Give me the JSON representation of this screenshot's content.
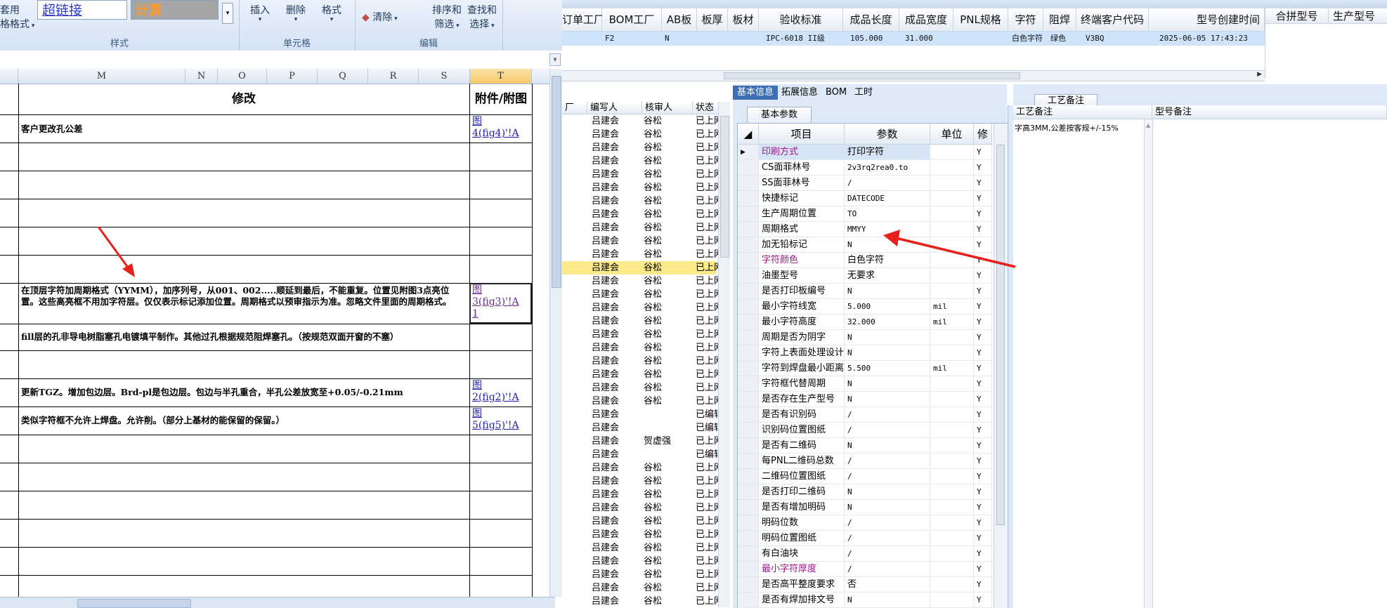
{
  "ribbon": {
    "style_group": {
      "label": "样式",
      "btn1": "套用",
      "btn2": "格格式",
      "hyperlink_style": "超链接",
      "calc_style": "计算"
    },
    "cells_group": {
      "label": "单元格",
      "insert": "插入",
      "delete": "删除",
      "format": "格式"
    },
    "edit_group": {
      "label": "编辑",
      "clear": "清除",
      "sort_filter_1": "排序和",
      "sort_filter_2": "筛选",
      "find_select_1": "查找和",
      "find_select_2": "选择"
    }
  },
  "sheet": {
    "columns": [
      "M",
      "N",
      "O",
      "P",
      "Q",
      "R",
      "S",
      "T"
    ],
    "header_modify": "修改",
    "header_attach": "附件/附图",
    "rows": [
      {
        "text": "客户更改孔公差",
        "link": "图\n4(fig4)'!A"
      },
      {
        "text": "",
        "link": ""
      },
      {
        "text": "",
        "link": ""
      },
      {
        "text": "",
        "link": ""
      },
      {
        "text": "",
        "link": ""
      },
      {
        "text": "",
        "link": ""
      },
      {
        "text": "在顶层字符加周期格式（YYMM），加序列号，从001、002.....顺延到最后，不能重复。位置见附图3点亮位置。这些高亮框不用加字符层。仅仅表示标记添加位置。周期格式以预审指示为准。忽略文件里面的周期格式。",
        "link": "图\n3(fig3)'!A\n1"
      },
      {
        "text": "fill层的孔非导电树脂塞孔电镀填平制作。其他过孔根据规范阻焊塞孔。（按规范双面开窗的不塞）",
        "link": ""
      },
      {
        "text": "",
        "link": ""
      },
      {
        "text": "更新TGZ。增加包边层。Brd-pl是包边层。包边与半孔重合，半孔公差放宽至+0.05/-0.21mm",
        "link": "图\n2(fig2)'!A"
      },
      {
        "text": "类似字符框不允许上焊盘。允许削。（部分上基材的能保留的保留。）",
        "link": "图\n5(fig5)'!A"
      }
    ]
  },
  "erp_top": {
    "headers": [
      "订单工厂",
      "BOM工厂",
      "AB板",
      "板厚",
      "板材",
      "验收标准",
      "成品长度",
      "成品宽度",
      "PNL规格",
      "字符",
      "阻焊",
      "终端客户代码",
      "型号创建时间",
      "合拼型号",
      "生产型号"
    ],
    "row": [
      "F2",
      "N",
      "",
      "",
      "IPC-6018 II级",
      "105.000",
      "31.000",
      "",
      "白色字符",
      "绿色",
      "V3BQ",
      "2025-06-05 17:43:23"
    ]
  },
  "erp_list": {
    "headers": [
      "订单工厂",
      "编写人",
      "核审人",
      "状态"
    ],
    "rows": [
      [
        "吕建会",
        "谷松",
        "已上网"
      ],
      [
        "吕建会",
        "谷松",
        "已上网"
      ],
      [
        "吕建会",
        "谷松",
        "已上网"
      ],
      [
        "吕建会",
        "谷松",
        "已上网"
      ],
      [
        "吕建会",
        "谷松",
        "已上网"
      ],
      [
        "吕建会",
        "谷松",
        "已上网"
      ],
      [
        "吕建会",
        "谷松",
        "已上网"
      ],
      [
        "吕建会",
        "谷松",
        "已上网"
      ],
      [
        "吕建会",
        "谷松",
        "已上网"
      ],
      [
        "吕建会",
        "谷松",
        "已上网"
      ],
      [
        "吕建会",
        "谷松",
        "已上网"
      ],
      [
        "吕建会",
        "谷松",
        "已上网"
      ],
      [
        "吕建会",
        "谷松",
        "已上网"
      ],
      [
        "吕建会",
        "谷松",
        "已上网"
      ],
      [
        "吕建会",
        "谷松",
        "已上网"
      ],
      [
        "吕建会",
        "谷松",
        "已上网"
      ],
      [
        "吕建会",
        "谷松",
        "已上网"
      ],
      [
        "吕建会",
        "谷松",
        "已上网"
      ],
      [
        "吕建会",
        "谷松",
        "已上网"
      ],
      [
        "吕建会",
        "谷松",
        "已上网"
      ],
      [
        "吕建会",
        "谷松",
        "已上网"
      ],
      [
        "吕建会",
        "谷松",
        "已上网"
      ],
      [
        "吕建会",
        "",
        "已编辑"
      ],
      [
        "吕建会",
        "",
        "已编辑"
      ],
      [
        "吕建会",
        "贺虚强",
        "已上网"
      ],
      [
        "吕建会",
        "",
        "已编辑"
      ],
      [
        "吕建会",
        "谷松",
        "已上网"
      ],
      [
        "吕建会",
        "谷松",
        "已上网"
      ],
      [
        "吕建会",
        "谷松",
        "已上网"
      ],
      [
        "吕建会",
        "谷松",
        "已上网"
      ],
      [
        "吕建会",
        "谷松",
        "已上网"
      ],
      [
        "吕建会",
        "谷松",
        "已上网"
      ],
      [
        "吕建会",
        "谷松",
        "已上网"
      ],
      [
        "吕建会",
        "谷松",
        "已上网"
      ],
      [
        "吕建会",
        "谷松",
        "已上网"
      ],
      [
        "吕建会",
        "谷松",
        "已上网"
      ],
      [
        "吕建会",
        "谷松",
        "已上网"
      ]
    ],
    "highlight_row": 11
  },
  "detail": {
    "tabs": [
      "基本信息",
      "拓展信息",
      "BOM",
      "工时"
    ],
    "subtab": "基本参数",
    "prop_headers": [
      "项目",
      "参数",
      "单位",
      "修"
    ],
    "props": [
      {
        "name": "印刷方式",
        "value": "打印字符",
        "unit": "",
        "flag": "Y",
        "pink": true
      },
      {
        "name": "CS面菲林号",
        "value": "2v3rq2rea0.to",
        "unit": "",
        "flag": "Y"
      },
      {
        "name": "SS面菲林号",
        "value": "/",
        "unit": "",
        "flag": "Y"
      },
      {
        "name": "快捷标记",
        "value": "DATECODE",
        "unit": "",
        "flag": "Y"
      },
      {
        "name": "生产周期位置",
        "value": "TO",
        "unit": "",
        "flag": "Y"
      },
      {
        "name": "周期格式",
        "value": "MMYY",
        "unit": "",
        "flag": "Y"
      },
      {
        "name": "加无铅标记",
        "value": "N",
        "unit": "",
        "flag": "Y"
      },
      {
        "name": "字符颜色",
        "value": "白色字符",
        "unit": "",
        "flag": "Y",
        "pink": true
      },
      {
        "name": "油墨型号",
        "value": "无要求",
        "unit": "",
        "flag": "Y"
      },
      {
        "name": "是否打印板编号",
        "value": "N",
        "unit": "",
        "flag": "Y"
      },
      {
        "name": "最小字符线宽",
        "value": "5.000",
        "unit": "mil",
        "flag": "Y"
      },
      {
        "name": "最小字符高度",
        "value": "32.000",
        "unit": "mil",
        "flag": "Y"
      },
      {
        "name": "周期是否为阴字",
        "value": "N",
        "unit": "",
        "flag": "Y"
      },
      {
        "name": "字符上表面处理设计",
        "value": "N",
        "unit": "",
        "flag": "Y"
      },
      {
        "name": "字符到焊盘最小距离",
        "value": "5.500",
        "unit": "mil",
        "flag": "Y"
      },
      {
        "name": "字符框代替周期",
        "value": "N",
        "unit": "",
        "flag": "Y"
      },
      {
        "name": "是否存在生产型号",
        "value": "N",
        "unit": "",
        "flag": "Y"
      },
      {
        "name": "是否有识别码",
        "value": "/",
        "unit": "",
        "flag": "Y"
      },
      {
        "name": "识别码位置图纸",
        "value": "/",
        "unit": "",
        "flag": "Y"
      },
      {
        "name": "是否有二维码",
        "value": "N",
        "unit": "",
        "flag": "Y"
      },
      {
        "name": "每PNL二维码总数",
        "value": "/",
        "unit": "",
        "flag": "Y"
      },
      {
        "name": "二维码位置图纸",
        "value": "/",
        "unit": "",
        "flag": "Y"
      },
      {
        "name": "是否打印二维码",
        "value": "N",
        "unit": "",
        "flag": "Y"
      },
      {
        "name": "是否有增加明码",
        "value": "N",
        "unit": "",
        "flag": "Y"
      },
      {
        "name": "明码位数",
        "value": "/",
        "unit": "",
        "flag": "Y"
      },
      {
        "name": "明码位置图纸",
        "value": "/",
        "unit": "",
        "flag": "Y"
      },
      {
        "name": "有白油块",
        "value": "/",
        "unit": "",
        "flag": "Y"
      },
      {
        "name": "最小字符厚度",
        "value": "/",
        "unit": "",
        "flag": "Y",
        "pink": true
      },
      {
        "name": "是否高平整度要求",
        "value": "否",
        "unit": "",
        "flag": "Y"
      },
      {
        "name": "是否有焊加排文号",
        "value": "N",
        "unit": "",
        "flag": "Y"
      }
    ]
  },
  "process": {
    "tab": "工艺备注",
    "col1": "工艺备注",
    "col2": "型号备注",
    "note": "字高3MM,公差按客规+/-15%"
  },
  "colors": {
    "arrow": "#e8201c",
    "accent": "#3d6db3",
    "selection": "#cfe3fb",
    "highlight_row": "#fce98a",
    "pink_text": "#a0178a"
  }
}
